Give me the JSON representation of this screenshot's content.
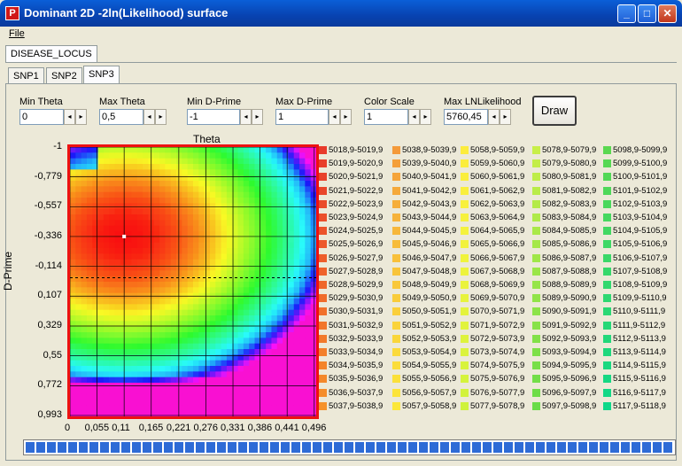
{
  "window": {
    "title": "Dominant 2D -2ln(Likelihood) surface",
    "app_icon_glyph": "P",
    "minimize_glyph": "_",
    "maximize_glyph": "□",
    "close_glyph": "✕"
  },
  "menu": {
    "file": "File"
  },
  "tabs": {
    "outer": "DISEASE_LOCUS",
    "inner": [
      "SNP1",
      "SNP2",
      "SNP3"
    ],
    "active_inner": 2
  },
  "params": {
    "min_theta": {
      "label": "Min Theta",
      "value": "0"
    },
    "max_theta": {
      "label": "Max Theta",
      "value": "0,5"
    },
    "min_dprime": {
      "label": "Min D-Prime",
      "value": "-1"
    },
    "max_dprime": {
      "label": "Max D-Prime",
      "value": "1"
    },
    "color_scale": {
      "label": "Color Scale",
      "value": "1"
    },
    "max_lnl": {
      "label": "Max LNLikelihood",
      "value": "5760,45"
    },
    "spin_left": "◂",
    "spin_right": "▸"
  },
  "draw_label": "Draw",
  "chart_data": {
    "type": "heatmap",
    "xlabel": "Theta",
    "ylabel": "D-Prime",
    "x_ticks": [
      "0",
      "0,055",
      "0,11",
      "0,165",
      "0,221",
      "0,276",
      "0,331",
      "0,386",
      "0,441",
      "0,496"
    ],
    "y_ticks": [
      "-1",
      "-0,779",
      "-0,557",
      "-0,336",
      "-0,114",
      "0,107",
      "0,329",
      "0,55",
      "0,772",
      "0,993"
    ],
    "xlim": [
      0,
      0.5
    ],
    "ylim": [
      -1,
      1
    ],
    "minimum_point": {
      "theta": 0.11,
      "dprime": -0.336
    },
    "dashed_line_dprime": -0.03,
    "legend": {
      "columns": [
        [
          "5018,9-5019,9",
          "5019,9-5020,9",
          "5020,9-5021,9",
          "5021,9-5022,9",
          "5022,9-5023,9",
          "5023,9-5024,9",
          "5024,9-5025,9",
          "5025,9-5026,9",
          "5026,9-5027,9",
          "5027,9-5028,9",
          "5028,9-5029,9",
          "5029,9-5030,9",
          "5030,9-5031,9",
          "5031,9-5032,9",
          "5032,9-5033,9",
          "5033,9-5034,9",
          "5034,9-5035,9",
          "5035,9-5036,9",
          "5036,9-5037,9",
          "5037,9-5038,9"
        ],
        [
          "5038,9-5039,9",
          "5039,9-5040,9",
          "5040,9-5041,9",
          "5041,9-5042,9",
          "5042,9-5043,9",
          "5043,9-5044,9",
          "5044,9-5045,9",
          "5045,9-5046,9",
          "5046,9-5047,9",
          "5047,9-5048,9",
          "5048,9-5049,9",
          "5049,9-5050,9",
          "5050,9-5051,9",
          "5051,9-5052,9",
          "5052,9-5053,9",
          "5053,9-5054,9",
          "5054,9-5055,9",
          "5055,9-5056,9",
          "5056,9-5057,9",
          "5057,9-5058,9"
        ],
        [
          "5058,9-5059,9",
          "5059,9-5060,9",
          "5060,9-5061,9",
          "5061,9-5062,9",
          "5062,9-5063,9",
          "5063,9-5064,9",
          "5064,9-5065,9",
          "5065,9-5066,9",
          "5066,9-5067,9",
          "5067,9-5068,9",
          "5068,9-5069,9",
          "5069,9-5070,9",
          "5070,9-5071,9",
          "5071,9-5072,9",
          "5072,9-5073,9",
          "5073,9-5074,9",
          "5074,9-5075,9",
          "5075,9-5076,9",
          "5076,9-5077,9",
          "5077,9-5078,9"
        ],
        [
          "5078,9-5079,9",
          "5079,9-5080,9",
          "5080,9-5081,9",
          "5081,9-5082,9",
          "5082,9-5083,9",
          "5083,9-5084,9",
          "5084,9-5085,9",
          "5085,9-5086,9",
          "5086,9-5087,9",
          "5087,9-5088,9",
          "5088,9-5089,9",
          "5089,9-5090,9",
          "5090,9-5091,9",
          "5091,9-5092,9",
          "5092,9-5093,9",
          "5093,9-5094,9",
          "5094,9-5095,9",
          "5095,9-5096,9",
          "5096,9-5097,9",
          "5097,9-5098,9"
        ],
        [
          "5098,9-5099,9",
          "5099,9-5100,9",
          "5100,9-5101,9",
          "5101,9-5102,9",
          "5102,9-5103,9",
          "5103,9-5104,9",
          "5104,9-5105,9",
          "5105,9-5106,9",
          "5106,9-5107,9",
          "5107,9-5108,9",
          "5108,9-5109,9",
          "5109,9-5110,9",
          "5110,9-5111,9",
          "5111,9-5112,9",
          "5112,9-5113,9",
          "5113,9-5114,9",
          "5114,9-5115,9",
          "5115,9-5116,9",
          "5116,9-5117,9",
          "5117,9-5118,9"
        ]
      ],
      "column_colors": [
        [
          "#e83a2a",
          "#e83e2a",
          "#e8422a",
          "#e9462a",
          "#ea4b2a",
          "#eb4f2a",
          "#ec532a",
          "#ed582a",
          "#ee5d2a",
          "#ef622a",
          "#ef672a",
          "#f06c2a",
          "#f1712a",
          "#f2762a",
          "#f27a2a",
          "#f37f2a",
          "#f4842a",
          "#f4882a",
          "#f58d2a",
          "#f6922a"
        ],
        [
          "#f49a3a",
          "#f49f3a",
          "#f5a43a",
          "#f5a93a",
          "#f6ae3a",
          "#f6b23a",
          "#f7b73a",
          "#f7bc3a",
          "#f8c03a",
          "#f8c43a",
          "#f9c83a",
          "#f9cc3a",
          "#facf3a",
          "#fad33a",
          "#fad63a",
          "#fbda3a",
          "#fbdd3a",
          "#fbe03a",
          "#fce43a",
          "#fce73a"
        ],
        [
          "#fcec3c",
          "#fbed3c",
          "#faee3c",
          "#f9ef3c",
          "#f8f03c",
          "#f6f13c",
          "#f4f23c",
          "#f2f23c",
          "#f0f33c",
          "#edf33c",
          "#eaf33c",
          "#e7f33c",
          "#e4f33c",
          "#e1f33c",
          "#def33c",
          "#dbf33c",
          "#d8f33c",
          "#d5f33c",
          "#d2f23c",
          "#cff23c"
        ],
        [
          "#c8ef48",
          "#c3ee48",
          "#beed48",
          "#b9ec48",
          "#b4eb48",
          "#afea48",
          "#aae948",
          "#a5e848",
          "#a0e748",
          "#9be648",
          "#96e548",
          "#91e448",
          "#8ce348",
          "#87e248",
          "#82e148",
          "#7de048",
          "#78df48",
          "#73de48",
          "#6edd48",
          "#69dc48"
        ],
        [
          "#5ad850",
          "#56d853",
          "#52d856",
          "#4ed859",
          "#4ad85c",
          "#46d85f",
          "#42d862",
          "#3ed865",
          "#3ad868",
          "#36d86b",
          "#32d86e",
          "#2ed871",
          "#2ad874",
          "#26d877",
          "#22d87a",
          "#1ed87d",
          "#1ad880",
          "#16d883",
          "#12d886",
          "#0ed889"
        ]
      ]
    }
  },
  "progress": {
    "fraction": 1.0,
    "color": "#2e6bd6"
  }
}
